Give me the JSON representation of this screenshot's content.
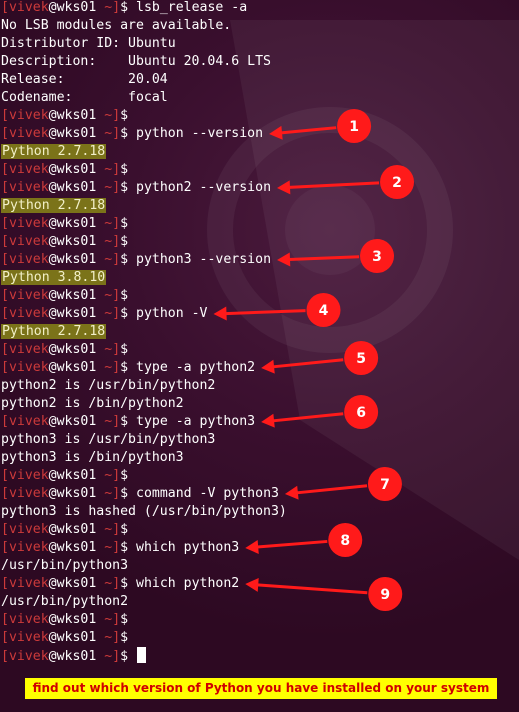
{
  "prompt": {
    "user": "vivek",
    "at": "@",
    "host": "wks01",
    "cwd": "~",
    "symbol": "$"
  },
  "lines": [
    {
      "type": "prompt",
      "cmd": "lsb_release -a"
    },
    {
      "type": "out",
      "text": "No LSB modules are available."
    },
    {
      "type": "out",
      "text": "Distributor ID: Ubuntu"
    },
    {
      "type": "out",
      "text": "Description:    Ubuntu 20.04.6 LTS"
    },
    {
      "type": "out",
      "text": "Release:        20.04"
    },
    {
      "type": "out",
      "text": "Codename:       focal"
    },
    {
      "type": "prompt",
      "cmd": ""
    },
    {
      "type": "prompt",
      "cmd": "python --version"
    },
    {
      "type": "hl",
      "text": "Python 2.7.18"
    },
    {
      "type": "prompt",
      "cmd": ""
    },
    {
      "type": "prompt",
      "cmd": "python2 --version"
    },
    {
      "type": "hl",
      "text": "Python 2.7.18"
    },
    {
      "type": "prompt",
      "cmd": ""
    },
    {
      "type": "prompt",
      "cmd": ""
    },
    {
      "type": "prompt",
      "cmd": "python3 --version"
    },
    {
      "type": "hl",
      "text": "Python 3.8.10"
    },
    {
      "type": "prompt",
      "cmd": ""
    },
    {
      "type": "prompt",
      "cmd": "python -V"
    },
    {
      "type": "hl",
      "text": "Python 2.7.18"
    },
    {
      "type": "prompt",
      "cmd": ""
    },
    {
      "type": "prompt",
      "cmd": "type -a python2"
    },
    {
      "type": "out",
      "text": "python2 is /usr/bin/python2"
    },
    {
      "type": "out",
      "text": "python2 is /bin/python2"
    },
    {
      "type": "prompt",
      "cmd": "type -a python3"
    },
    {
      "type": "out",
      "text": "python3 is /usr/bin/python3"
    },
    {
      "type": "out",
      "text": "python3 is /bin/python3"
    },
    {
      "type": "prompt",
      "cmd": ""
    },
    {
      "type": "prompt",
      "cmd": "command -V python3"
    },
    {
      "type": "out",
      "text": "python3 is hashed (/usr/bin/python3)"
    },
    {
      "type": "prompt",
      "cmd": ""
    },
    {
      "type": "prompt",
      "cmd": "which python3"
    },
    {
      "type": "out",
      "text": "/usr/bin/python3"
    },
    {
      "type": "prompt",
      "cmd": "which python2"
    },
    {
      "type": "out",
      "text": "/usr/bin/python2"
    },
    {
      "type": "prompt",
      "cmd": ""
    },
    {
      "type": "prompt",
      "cmd": ""
    },
    {
      "type": "prompt",
      "cmd": "",
      "cursor": true
    }
  ],
  "annotations": [
    {
      "number": "1",
      "line": 7
    },
    {
      "number": "2",
      "line": 10
    },
    {
      "number": "3",
      "line": 14
    },
    {
      "number": "4",
      "line": 17
    },
    {
      "number": "5",
      "line": 20
    },
    {
      "number": "6",
      "line": 23
    },
    {
      "number": "7",
      "line": 27
    },
    {
      "number": "8",
      "line": 30
    },
    {
      "number": "9",
      "line": 32
    }
  ],
  "caption": "find out which version of Python you have installed on your system",
  "colors": {
    "background": "#2d0922",
    "prompt_red": "#cc3a3a",
    "highlight": "#7b7319",
    "annotation_red": "#ff1a1a",
    "caption_bg": "#ffff00",
    "caption_text": "#d00000"
  }
}
